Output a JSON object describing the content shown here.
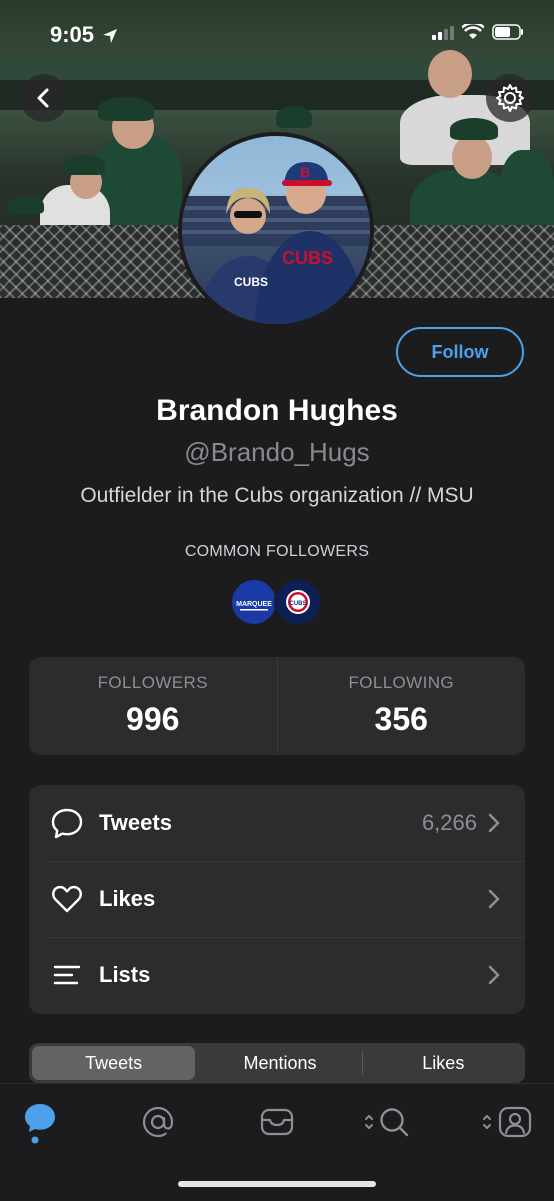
{
  "status_bar": {
    "time": "9:05"
  },
  "profile": {
    "name": "Brandon Hughes",
    "handle": "@Brando_Hugs",
    "bio": "Outfielder in the Cubs organization // MSU",
    "follow_label": "Follow"
  },
  "common_followers": {
    "label": "COMMON FOLLOWERS",
    "accounts": [
      {
        "icon": "marquee-logo",
        "text": "MARQUEE"
      },
      {
        "icon": "cubs-logo",
        "text": "CUBS"
      }
    ]
  },
  "stats": {
    "followers_label": "FOLLOWERS",
    "followers_value": "996",
    "following_label": "FOLLOWING",
    "following_value": "356"
  },
  "menu": [
    {
      "label": "Tweets",
      "count": "6,266",
      "icon": "speech-bubble-icon"
    },
    {
      "label": "Likes",
      "count": "",
      "icon": "heart-icon"
    },
    {
      "label": "Lists",
      "count": "",
      "icon": "list-icon"
    }
  ],
  "segments": {
    "tweets": "Tweets",
    "mentions": "Mentions",
    "likes": "Likes",
    "active": "Tweets"
  },
  "tab_bar": [
    "timeline-icon",
    "mentions-icon",
    "messages-icon",
    "search-icon",
    "profile-icon"
  ],
  "colors": {
    "accent": "#4ca1ea",
    "background": "#1c1c1e",
    "card": "#2c2c2e"
  }
}
